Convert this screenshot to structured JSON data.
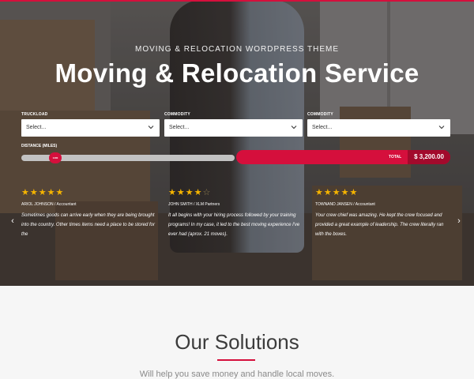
{
  "hero": {
    "eyebrow": "MOVING & RELOCATION WORDPRESS THEME",
    "title": "Moving & Relocation Service"
  },
  "form": {
    "fields": [
      {
        "label": "TRUCKLOAD",
        "value": "Select..."
      },
      {
        "label": "COMMODITY",
        "value": "Select..."
      },
      {
        "label": "COMMODITY",
        "value": "Select..."
      }
    ],
    "distance_label": "DISTANCE (MILES)",
    "slider_value": "1400",
    "total_label": "TOTAL",
    "total_value": "$ 3,200.00"
  },
  "testimonials": [
    {
      "stars": 5,
      "author": "ARIOL JOHNSON / Accountant",
      "quote": "Sometimes goods can arrive early when they are being brought into the country. Other times items need a place to be stored for the"
    },
    {
      "stars": 4,
      "author": "JOHN SMITH / XLM Partners",
      "quote": "It all begins with your hiring process followed by your training programs! In my case, it led to the best moving experience I've ever had (aprox. 21 moves)."
    },
    {
      "stars": 5,
      "author": "TOWNAND JANSEN / Accountant",
      "quote": "Your crew chief was amazing. He kept the crew focused and provided a great example of leadership. The crew literally ran with the boxes."
    }
  ],
  "nav": {
    "prev": "‹",
    "next": "›"
  },
  "solutions": {
    "title": "Our Solutions",
    "subtitle": "Will help you save money and handle local moves."
  },
  "colors": {
    "accent": "#d50f3c",
    "accent_dark": "#a20a2c",
    "star": "#f5b400"
  },
  "icons": [
    "chevron-down-icon",
    "star-icon",
    "arrow-left-icon",
    "arrow-right-icon"
  ]
}
